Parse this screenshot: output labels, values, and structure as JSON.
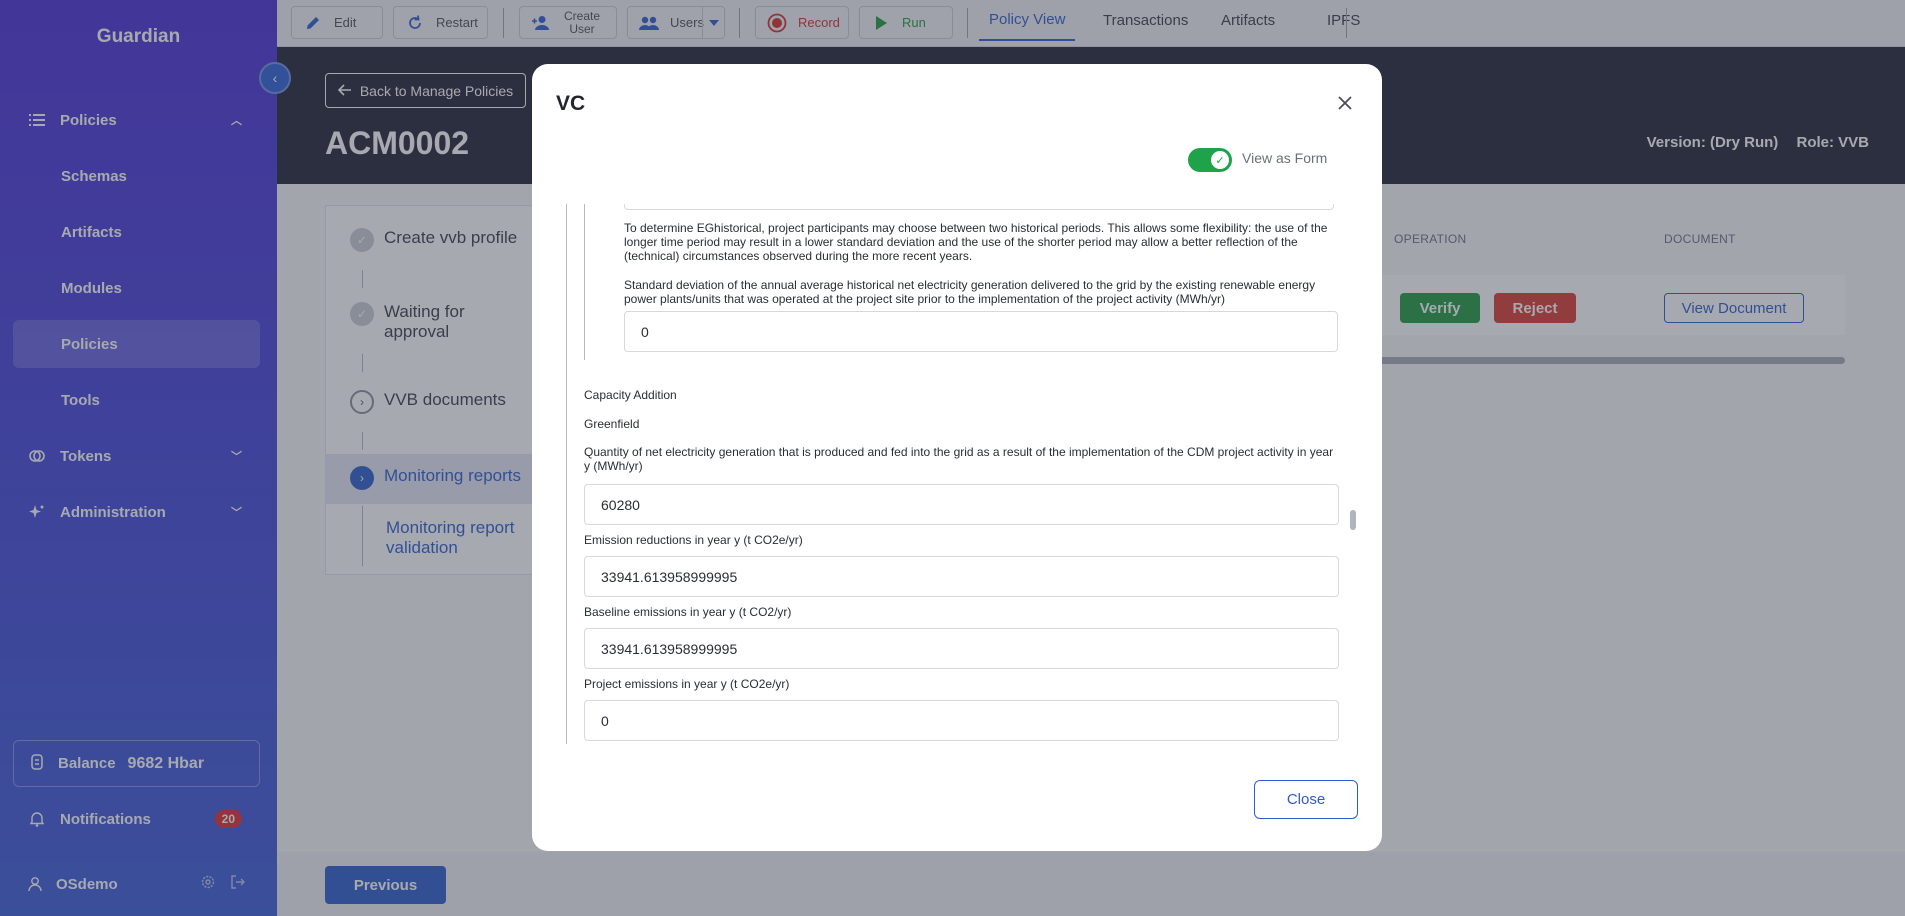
{
  "sidebar": {
    "brand": "Guardian",
    "items": [
      {
        "label": "Policies",
        "icon": "list-icon"
      },
      {
        "label": "Schemas"
      },
      {
        "label": "Artifacts"
      },
      {
        "label": "Modules"
      },
      {
        "label": "Policies"
      },
      {
        "label": "Tools"
      },
      {
        "label": "Tokens",
        "icon": "tokens-icon"
      },
      {
        "label": "Administration",
        "icon": "sparkle-icon"
      }
    ],
    "balance_label": "Balance",
    "balance_value": "9682 Hbar",
    "notifications_label": "Notifications",
    "notifications_count": "20",
    "user": "OSdemo"
  },
  "toolbar": {
    "edit": "Edit",
    "restart": "Restart",
    "create_user": "Create User",
    "users": "Users",
    "record": "Record",
    "run": "Run",
    "tabs": [
      "Policy View",
      "Transactions",
      "Artifacts",
      "IPFS"
    ]
  },
  "header": {
    "back": "Back to Manage Policies",
    "title": "ACM0002",
    "version": "Version: (Dry Run)",
    "role": "Role: VVB"
  },
  "steps": [
    {
      "label": "Create vvb profile"
    },
    {
      "label": "Waiting for approval"
    },
    {
      "label": "VVB documents"
    },
    {
      "label": "Monitoring reports"
    },
    {
      "label": "Monitoring report validation"
    }
  ],
  "table": {
    "col_operation": "OPERATION",
    "col_document": "DOCUMENT",
    "verify": "Verify",
    "reject": "Reject",
    "view_document": "View Document"
  },
  "footer": {
    "previous": "Previous"
  },
  "modal": {
    "title": "VC",
    "toggle_label": "View as Form",
    "eg_text": "To determine EGhistorical, project participants may choose between two historical periods. This allows some flexibility: the use of the longer time period may result in a lower standard deviation and the use of the shorter period may allow a better reflection of the (technical) circumstances observed during the more recent years.",
    "stddev_label": "Standard deviation of the annual average historical net electricity generation delivered to the grid by the existing renewable energy power plants/units that was operated at the project site prior to the implementation of the project activity (MWh/yr)",
    "stddev_value": "0",
    "capacity_addition": "Capacity Addition",
    "greenfield": "Greenfield",
    "quantity_label": "Quantity of net electricity generation that is produced and fed into the grid as a result of the implementation of the CDM project activity in year y (MWh/yr)",
    "quantity_value": "60280",
    "er_label": "Emission reductions in year y (t CO2e/yr)",
    "er_value": "33941.613958999995",
    "be_label": "Baseline emissions in year y (t CO2/yr)",
    "be_value": "33941.613958999995",
    "pe_label": "Project emissions in year y (t CO2e/yr)",
    "pe_value": "0",
    "close": "Close"
  },
  "colors": {
    "sidebar_top": "#4a2ed6",
    "sidebar_bottom": "#3a5bd8",
    "accent": "#2c5ccd",
    "verify": "#1e9a3c",
    "reject": "#d83a2e",
    "toggle_on": "#1fa34a",
    "header_bg": "#1f2233"
  }
}
